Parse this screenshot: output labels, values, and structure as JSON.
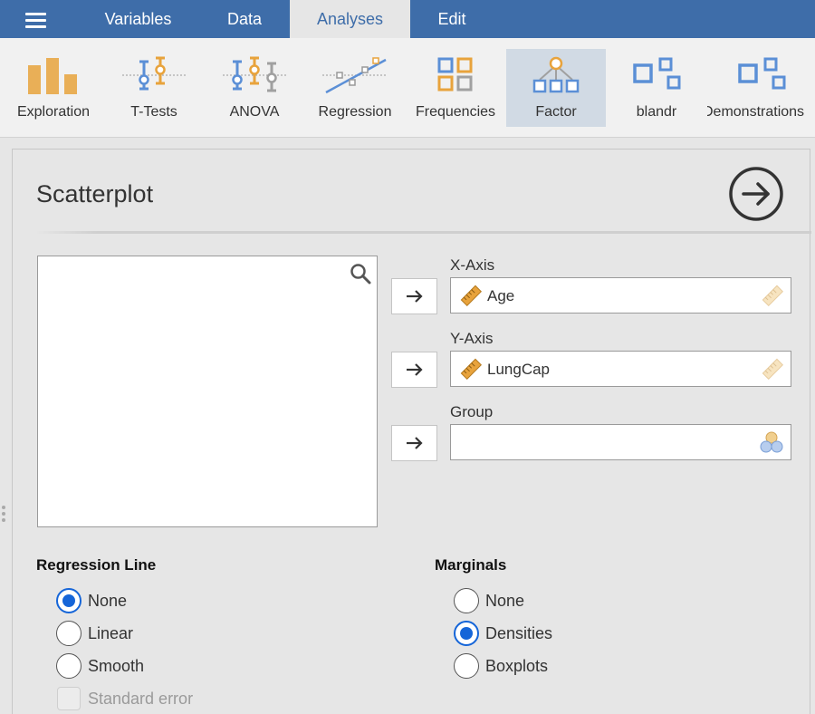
{
  "menu": {
    "tabs": [
      {
        "label": "Variables"
      },
      {
        "label": "Data"
      },
      {
        "label": "Analyses"
      },
      {
        "label": "Edit"
      }
    ],
    "active_tab": "Analyses"
  },
  "ribbon": {
    "items": [
      {
        "label": "Exploration",
        "icon": "exploration-icon"
      },
      {
        "label": "T-Tests",
        "icon": "t-tests-icon"
      },
      {
        "label": "ANOVA",
        "icon": "anova-icon"
      },
      {
        "label": "Regression",
        "icon": "regression-icon"
      },
      {
        "label": "Frequencies",
        "icon": "frequencies-icon"
      },
      {
        "label": "Factor",
        "icon": "factor-icon"
      },
      {
        "label": "blandr",
        "icon": "blandr-icon"
      },
      {
        "label": "Demonstrations",
        "icon": "demonstrations-icon"
      }
    ],
    "active_item": "Factor"
  },
  "panel": {
    "title": "Scatterplot",
    "targets": {
      "x_axis": {
        "label": "X-Axis",
        "value": "Age"
      },
      "y_axis": {
        "label": "Y-Axis",
        "value": "LungCap"
      },
      "group": {
        "label": "Group",
        "value": ""
      }
    },
    "regression_line": {
      "title": "Regression Line",
      "options": [
        "None",
        "Linear",
        "Smooth"
      ],
      "selected": "None",
      "standard_error_label": "Standard error",
      "standard_error_checked": false,
      "standard_error_enabled": false
    },
    "marginals": {
      "title": "Marginals",
      "options": [
        "None",
        "Densities",
        "Boxplots"
      ],
      "selected": "Densities"
    }
  },
  "colors": {
    "menubar": "#3e6da9",
    "accent_blue": "#1565d8",
    "icon_orange": "#e8a33c",
    "icon_blue": "#5b8fd6",
    "icon_gray": "#a0a0a0"
  }
}
